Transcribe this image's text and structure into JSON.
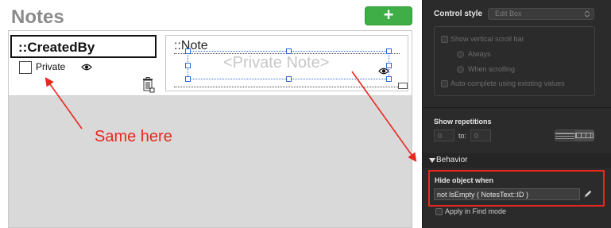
{
  "canvas": {
    "title": "Notes",
    "add_button_glyph": "+",
    "created_by_field": "::CreatedBy",
    "private_label": "Private",
    "note_label": "::Note",
    "note_placeholder": "<Private Note>",
    "annotation": "Same here",
    "icons": [
      "eye-icon",
      "trash-icon",
      "resize-icon",
      "add-icon"
    ]
  },
  "inspector": {
    "control_style": {
      "label": "Control style",
      "value": "Edit Box",
      "options": {
        "scrollbar": "Show vertical scroll bar",
        "always": "Always",
        "when_scrolling": "When scrolling",
        "autocomplete": "Auto-complete using existing values"
      }
    },
    "repetitions": {
      "label": "Show repetitions",
      "from": "0",
      "to_label": "to:",
      "to": "0"
    },
    "behavior": {
      "header": "Behavior",
      "hide_label": "Hide object when",
      "hide_formula": "not IsEmpty ( NotesText::ID )",
      "apply_find": "Apply in Find mode"
    }
  },
  "colors": {
    "annotation_red": "#e8281e",
    "add_button_green": "#3fae46",
    "inspector_bg": "#2b2b2b",
    "selection_blue": "#2d6bd3"
  }
}
